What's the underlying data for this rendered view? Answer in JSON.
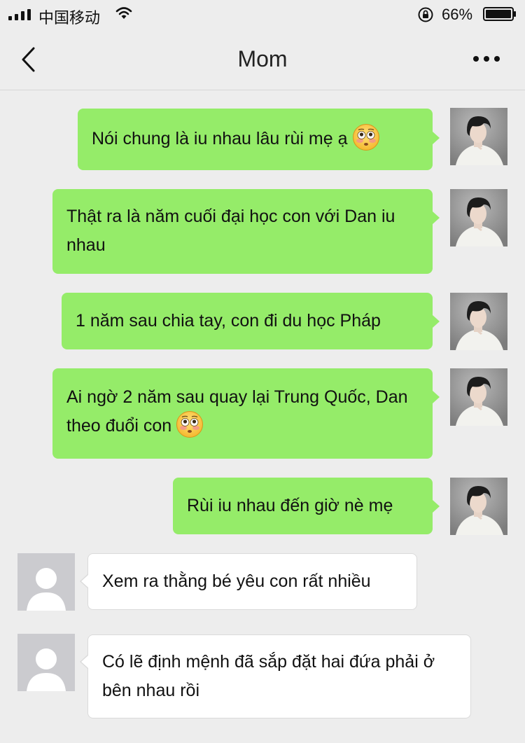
{
  "status_bar": {
    "carrier": "中国移动",
    "battery_percent": "66%",
    "battery_level": 0.66,
    "icons": [
      "signal-icon",
      "wifi-icon",
      "rotation-lock-icon",
      "battery-icon"
    ]
  },
  "nav": {
    "title": "Mom",
    "back_icon": "chevron-left-icon",
    "more_icon": "more-dots-icon"
  },
  "messages": [
    {
      "sender": "me",
      "text": "Nói chung là iu nhau lâu rùi mẹ ạ",
      "emoji": "flushed-face"
    },
    {
      "sender": "me",
      "text": "Thật ra là năm cuối đại học con với Dan iu nhau"
    },
    {
      "sender": "me",
      "text": "1 năm sau chia tay, con đi du học Pháp"
    },
    {
      "sender": "me",
      "text": "Ai ngờ 2 năm sau quay lại Trung Quốc, Dan theo đuổi con",
      "emoji": "flushed-face"
    },
    {
      "sender": "me",
      "text": "Rùi iu nhau đến giờ nè mẹ"
    },
    {
      "sender": "mom",
      "text": "Xem ra thằng bé yêu con rất nhiều"
    },
    {
      "sender": "mom",
      "text": "Có lẽ định mệnh đã sắp đặt hai đứa phải ở bên nhau rồi"
    }
  ],
  "colors": {
    "background": "#ededed",
    "outgoing_bubble": "#95ec69",
    "incoming_bubble": "#ffffff"
  }
}
